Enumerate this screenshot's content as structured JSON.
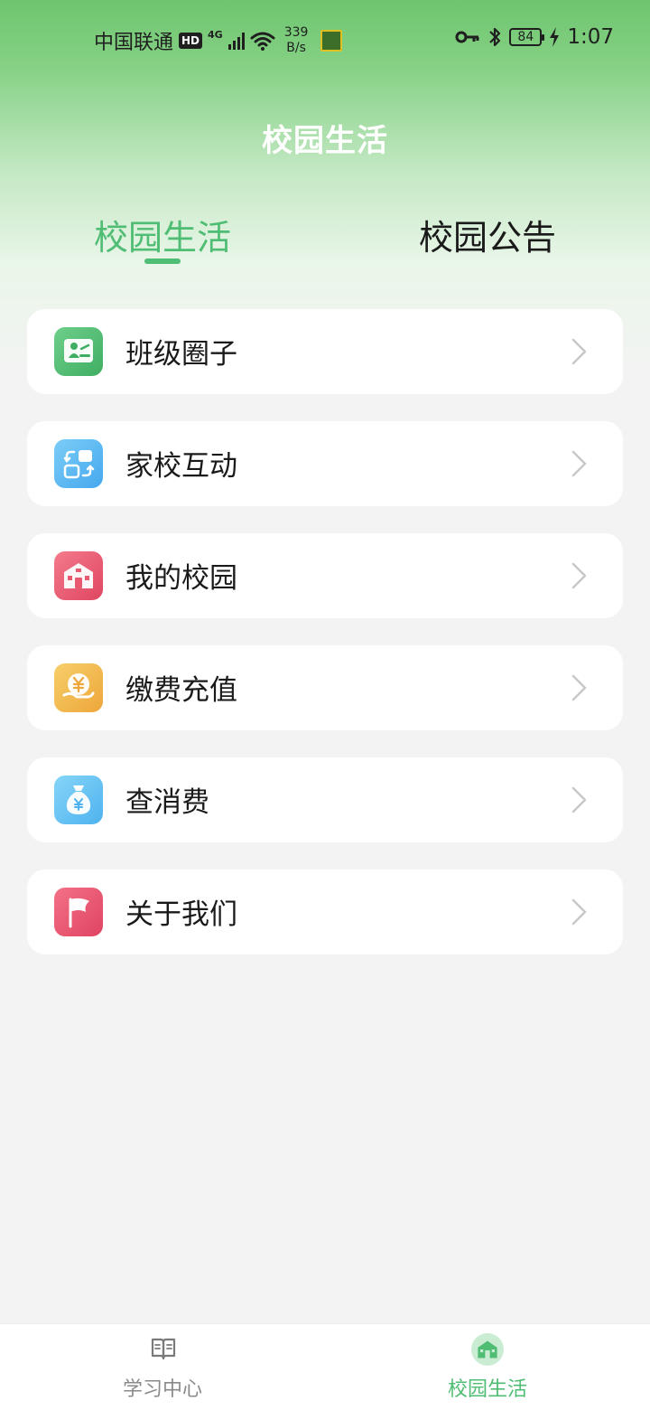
{
  "status_bar": {
    "carrier": "中国联通",
    "hd": "HD",
    "network": "4G",
    "speed_value": "339",
    "speed_unit": "B/s",
    "battery": "84",
    "time": "1:07"
  },
  "header": {
    "title": "校园生活"
  },
  "tabs": [
    {
      "label": "校园生活",
      "active": true
    },
    {
      "label": "校园公告",
      "active": false
    }
  ],
  "menu": {
    "items": [
      {
        "label": "班级圈子",
        "icon": "class-circle-icon"
      },
      {
        "label": "家校互动",
        "icon": "home-school-interaction-icon"
      },
      {
        "label": "我的校园",
        "icon": "school-building-icon"
      },
      {
        "label": "缴费充值",
        "icon": "yen-coin-hand-icon"
      },
      {
        "label": "查消费",
        "icon": "money-bag-icon"
      },
      {
        "label": "关于我们",
        "icon": "flag-icon"
      }
    ]
  },
  "bottom_nav": {
    "items": [
      {
        "label": "学习中心",
        "icon": "book-icon",
        "active": false
      },
      {
        "label": "校园生活",
        "icon": "school-building-icon",
        "active": true
      }
    ]
  },
  "colors": {
    "accent": "#4fbd73",
    "header_green": "#6ec56e"
  }
}
